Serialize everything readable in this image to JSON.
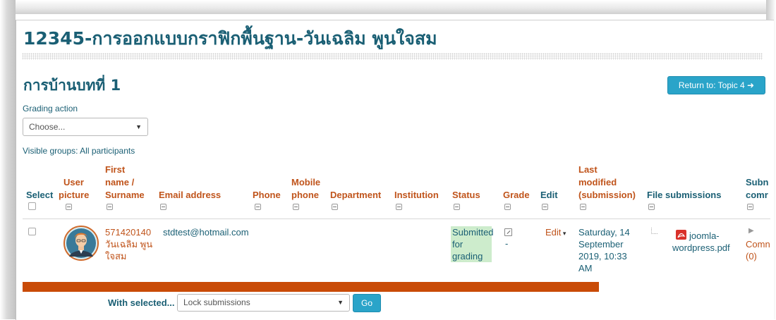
{
  "course_title": "12345-การออกแบบกราฟิกพื้นฐาน-วันเฉลิม พูนใจสม",
  "assignment_title": "การบ้านบทที่ 1",
  "return_button": "Return to: Topic 4 ➜",
  "grading_action": {
    "label": "Grading action",
    "selected": "Choose..."
  },
  "visible_groups": "Visible groups: All participants",
  "columns": {
    "select": "Select",
    "user_picture": [
      "User",
      "picture"
    ],
    "name": [
      "First",
      "name /",
      "Surname"
    ],
    "email": "Email address",
    "phone": "Phone",
    "mobile": [
      "Mobile",
      "phone"
    ],
    "department": "Department",
    "institution": "Institution",
    "status": "Status",
    "grade": "Grade",
    "edit": "Edit",
    "last_modified": [
      "Last",
      "modified",
      "(submission)"
    ],
    "file_submissions": "File submissions",
    "submission_comments": [
      "Subn",
      "comr"
    ]
  },
  "row": {
    "id": "571420140",
    "name_line1": "วันเฉลิม พูน",
    "name_line2": "ใจสม",
    "email": "stdtest@hotmail.com",
    "status": [
      "Submitted",
      "for",
      "grading"
    ],
    "grade": "-",
    "edit": "Edit",
    "last_modified": [
      "Saturday, 14",
      "September",
      "2019, 10:33",
      "AM"
    ],
    "file_name": [
      "joomla-",
      "wordpress.pdf"
    ],
    "comments": [
      "Comn",
      "(0)"
    ]
  },
  "with_selected": {
    "label": "With selected...",
    "selected": "Lock submissions",
    "go": "Go"
  },
  "colors": {
    "accent": "#2aa4c9",
    "heading": "#1a5f74",
    "link": "#c0541b",
    "bar": "#c94b07",
    "status_bg": "#cdeccc"
  }
}
